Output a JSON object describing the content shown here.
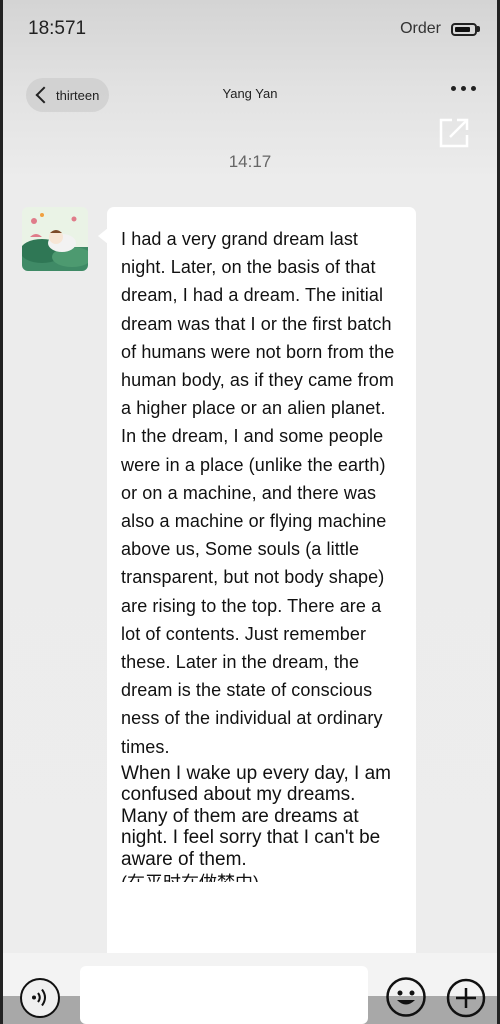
{
  "status_bar": {
    "time": "18:571",
    "label": "Order"
  },
  "nav": {
    "back_label": "thirteen",
    "title": "Yang Yan"
  },
  "chat": {
    "timestamp": "14:17",
    "message": {
      "paragraph1": "I had a very grand dream last night. Later, on the basis of that dream, I had a dream. The initial dream was that I or the first batch of humans were not born from the human body, as if they came from a higher place or an alien planet. In the dream, I and some people were in a place (unlike the earth) or on a machine, and there was also a machine or flying machine above us, Some souls (a little transparent, but not body shape) are rising to the top. There are a lot of contents. Just remember these. Later in the dream, the dream is the state of conscious ness of the individual at ordinary times.",
      "paragraph2": "When I wake up every day, I am confused about my dreams. Many of them are dreams at night. I feel sorry that I can't be aware of them.",
      "cutoff_line": "(在平时在做梦中)"
    }
  },
  "icons": {
    "back": "chevron-left-icon",
    "more": "more-horizontal-icon",
    "share": "share-external-icon",
    "voice": "voice-icon",
    "emoji": "emoji-icon",
    "add": "plus-circle-icon"
  },
  "colors": {
    "bubble": "#ffffff",
    "background": "#ededed",
    "text": "#111111"
  }
}
